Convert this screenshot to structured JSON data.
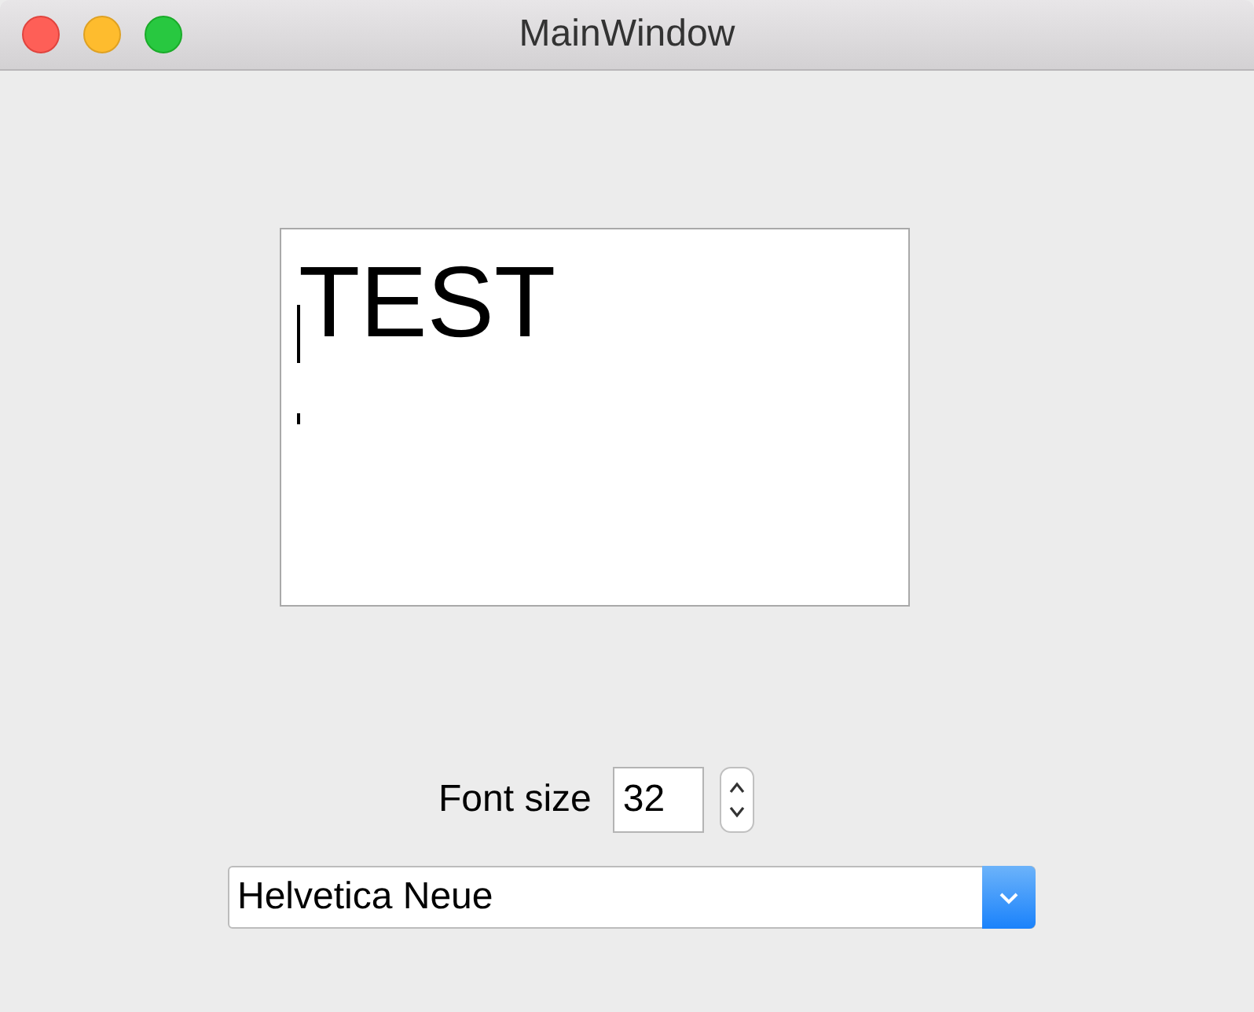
{
  "window": {
    "title": "MainWindow"
  },
  "editor": {
    "text": "TEST"
  },
  "font_size": {
    "label": "Font size",
    "value": "32"
  },
  "font_combo": {
    "value": "Helvetica Neue"
  }
}
